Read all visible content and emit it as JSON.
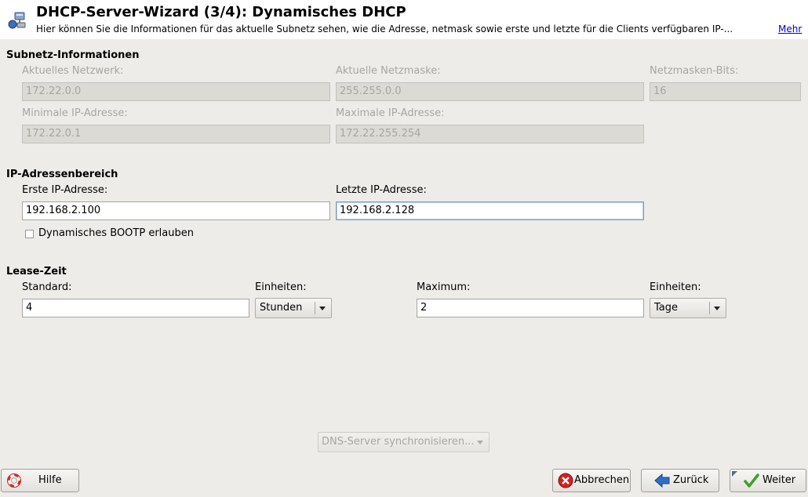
{
  "header": {
    "title": "DHCP-Server-Wizard (3/4): Dynamisches DHCP",
    "description": "Hier können Sie die Informationen für das aktuelle Subnetz sehen, wie die Adresse, netmask sowie erste und letzte für die Clients verfügbaren IP-...",
    "more_link": "Mehr",
    "icon": "network-server-icon"
  },
  "subnet": {
    "heading": "Subnetz-Informationen",
    "current_network_label": "Aktuelles Netzwerk:",
    "current_network_value": "172.22.0.0",
    "current_netmask_label": "Aktuelle Netzmaske:",
    "current_netmask_value": "255.255.0.0",
    "netmask_bits_label": "Netzmasken-Bits:",
    "netmask_bits_value": "16",
    "min_ip_label": "Minimale IP-Adresse:",
    "min_ip_value": "172.22.0.1",
    "max_ip_label": "Maximale IP-Adresse:",
    "max_ip_value": "172.22.255.254"
  },
  "ip_range": {
    "heading": "IP-Adressenbereich",
    "first_ip_label": "Erste IP-Adresse:",
    "first_ip_value": "192.168.2.100",
    "last_ip_label": "Letzte IP-Adresse:",
    "last_ip_value": "192.168.2.128",
    "bootp_label": "Dynamisches BOOTP erlauben",
    "bootp_checked": false
  },
  "lease": {
    "heading": "Lease-Zeit",
    "standard_label": "Standard:",
    "standard_value": "4",
    "units1_label": "Einheiten:",
    "units1_value": "Stunden",
    "maximum_label": "Maximum:",
    "maximum_value": "2",
    "units2_label": "Einheiten:",
    "units2_value": "Tage"
  },
  "dns_sync_button": "DNS-Server synchronisieren...",
  "footer": {
    "help_label": "Hilfe",
    "cancel_label": "Abbrechen",
    "back_label": "Zurück",
    "next_label": "Weiter"
  },
  "colors": {
    "background": "#edece9",
    "link": "#0000cc",
    "cancel_red": "#d42020",
    "back_blue": "#2f6fc4",
    "next_green": "#3da02a"
  }
}
